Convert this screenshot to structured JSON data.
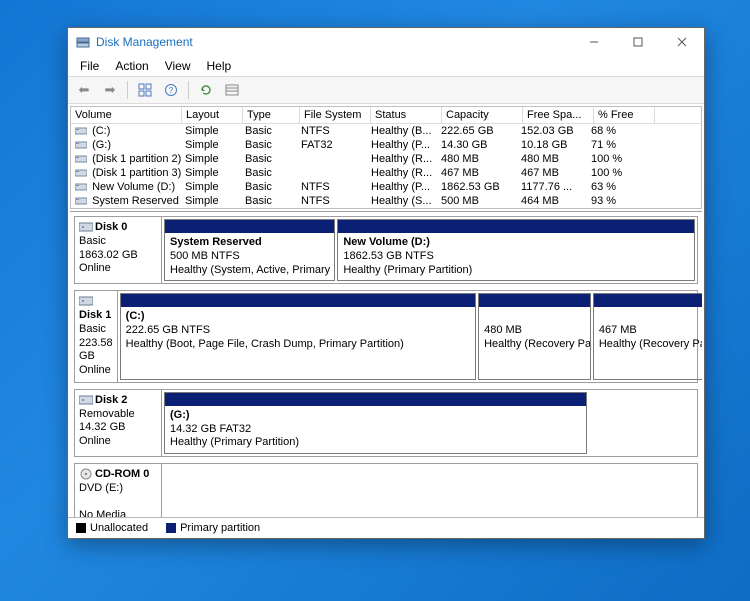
{
  "title": "Disk Management",
  "menu": {
    "file": "File",
    "action": "Action",
    "view": "View",
    "help": "Help"
  },
  "columns": {
    "volume": "Volume",
    "layout": "Layout",
    "type": "Type",
    "fs": "File System",
    "status": "Status",
    "capacity": "Capacity",
    "free": "Free Spa...",
    "pct": "% Free"
  },
  "volumes": [
    {
      "name": "(C:)",
      "layout": "Simple",
      "type": "Basic",
      "fs": "NTFS",
      "status": "Healthy (B...",
      "capacity": "222.65 GB",
      "free": "152.03 GB",
      "pct": "68 %"
    },
    {
      "name": "(G:)",
      "layout": "Simple",
      "type": "Basic",
      "fs": "FAT32",
      "status": "Healthy (P...",
      "capacity": "14.30 GB",
      "free": "10.18 GB",
      "pct": "71 %"
    },
    {
      "name": "(Disk 1 partition 2)",
      "layout": "Simple",
      "type": "Basic",
      "fs": "",
      "status": "Healthy (R...",
      "capacity": "480 MB",
      "free": "480 MB",
      "pct": "100 %"
    },
    {
      "name": "(Disk 1 partition 3)",
      "layout": "Simple",
      "type": "Basic",
      "fs": "",
      "status": "Healthy (R...",
      "capacity": "467 MB",
      "free": "467 MB",
      "pct": "100 %"
    },
    {
      "name": "New Volume (D:)",
      "layout": "Simple",
      "type": "Basic",
      "fs": "NTFS",
      "status": "Healthy (P...",
      "capacity": "1862.53 GB",
      "free": "1177.76 ...",
      "pct": "63 %"
    },
    {
      "name": "System Reserved",
      "layout": "Simple",
      "type": "Basic",
      "fs": "NTFS",
      "status": "Healthy (S...",
      "capacity": "500 MB",
      "free": "464 MB",
      "pct": "93 %"
    }
  ],
  "disks": [
    {
      "label": "Disk 0",
      "kind": "Basic",
      "size": "1863.02 GB",
      "state": "Online",
      "parts": [
        {
          "title": "System Reserved",
          "line2": "500 MB NTFS",
          "line3": "Healthy (System, Active, Primary Partit",
          "flex": 1
        },
        {
          "title": "New Volume  (D:)",
          "line2": "1862.53 GB NTFS",
          "line3": "Healthy (Primary Partition)",
          "flex": 2.1
        }
      ]
    },
    {
      "label": "Disk 1",
      "kind": "Basic",
      "size": "223.58 GB",
      "state": "Online",
      "parts": [
        {
          "title": " (C:)",
          "line2": "222.65 GB NTFS",
          "line3": "Healthy (Boot, Page File, Crash Dump, Primary Partition)",
          "flex": 3.2
        },
        {
          "title": "",
          "line2": "480 MB",
          "line3": "Healthy (Recovery Partition",
          "flex": 1
        },
        {
          "title": "",
          "line2": "467 MB",
          "line3": "Healthy (Recovery Partition",
          "flex": 1
        }
      ]
    },
    {
      "label": "Disk 2",
      "kind": "Removable",
      "size": "14.32 GB",
      "state": "Online",
      "parts": [
        {
          "title": " (G:)",
          "line2": "14.32 GB FAT32",
          "line3": "Healthy (Primary Partition)",
          "flex": 1
        }
      ],
      "fill": 0.68
    },
    {
      "label": "CD-ROM 0",
      "kind": "DVD (E:)",
      "size": "",
      "state": "No Media",
      "parts": []
    }
  ],
  "legend": {
    "unalloc": "Unallocated",
    "primary": "Primary partition"
  }
}
